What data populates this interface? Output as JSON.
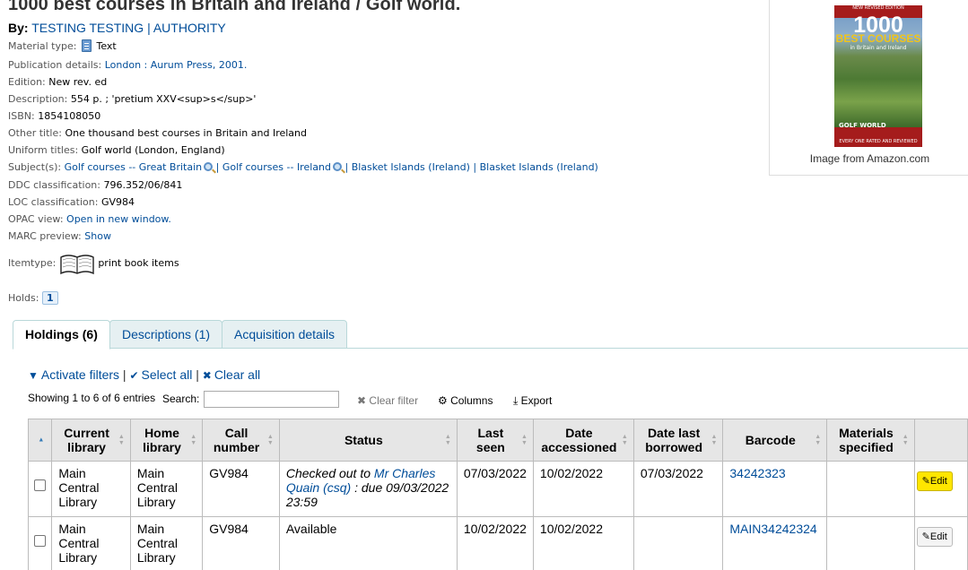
{
  "record": {
    "title": "1000 best courses in Britain and Ireland / Golf world.",
    "by_label": "By:",
    "authors": [
      "TESTING TESTING",
      "AUTHORITY"
    ],
    "author_sep": "|"
  },
  "fields": {
    "material_type": {
      "label": "Material type:",
      "value": "Text",
      "icon": "document-icon"
    },
    "publication": {
      "label": "Publication details:",
      "value": "London : Aurum Press, 2001."
    },
    "edition": {
      "label": "Edition:",
      "value": "New rev. ed"
    },
    "description": {
      "label": "Description:",
      "value": "554 p. ; 'pretium XXV<sup>s</sup>'"
    },
    "isbn": {
      "label": "ISBN:",
      "value": "1854108050"
    },
    "other_title": {
      "label": "Other title:",
      "value": "One thousand best courses in Britain and Ireland"
    },
    "uniform_titles": {
      "label": "Uniform titles:",
      "value": "Golf world (London, England)"
    },
    "subjects": {
      "label": "Subject(s):",
      "items": [
        "Golf courses -- Great Britain",
        "Golf courses -- Ireland",
        "Blasket Islands (Ireland)",
        "Blasket Islands (Ireland)"
      ],
      "sep": "|"
    },
    "ddc": {
      "label": "DDC classification:",
      "value": "796.352/06/841"
    },
    "loc": {
      "label": "LOC classification:",
      "value": "GV984"
    },
    "opac": {
      "label": "OPAC view:",
      "value": "Open in new window."
    },
    "marc": {
      "label": "MARC preview:",
      "value": "Show"
    },
    "itemtype": {
      "label": "Itemtype:",
      "value": "print book items",
      "icon": "open-book-icon"
    },
    "holds": {
      "label": "Holds:",
      "value": "1"
    }
  },
  "cover": {
    "caption": "Image from Amazon.com",
    "top_band": "NEW REVISED EDITION",
    "big": "1000",
    "sub": "BEST COURSES",
    "sub2": "in Britain and Ireland",
    "publisher_logo": "GOLF WORLD",
    "bottom_band": "EVERY ONE RATED AND REVIEWED"
  },
  "tabs": [
    {
      "label": "Holdings (6)",
      "active": true
    },
    {
      "label": "Descriptions (1)",
      "active": false
    },
    {
      "label": "Acquisition details",
      "active": false
    }
  ],
  "toolbar": {
    "activate_filters": "Activate filters",
    "select_all": "Select all",
    "clear_all": "Clear all",
    "showing": "Showing 1 to 6 of 6 entries",
    "search_label": "Search:",
    "clear_filter": "Clear filter",
    "columns": "Columns",
    "export": "Export",
    "pipe": "|"
  },
  "table": {
    "headers": [
      "Current library",
      "Home library",
      "Call number",
      "Status",
      "Last seen",
      "Date accessioned",
      "Date last borrowed",
      "Barcode",
      "Materials specified"
    ],
    "rows": [
      {
        "current_library": "Main Central Library",
        "home_library": "Main Central Library",
        "call_number": "GV984",
        "status_prefix": "Checked out to",
        "status_patron": "Mr Charles Quain (csq)",
        "status_suffix": ": due 09/03/2022 23:59",
        "last_seen": "07/03/2022",
        "date_accessioned": "10/02/2022",
        "date_last_borrowed": "07/03/2022",
        "barcode": "34242323",
        "materials": "",
        "edit": "Edit"
      },
      {
        "current_library": "Main Central Library",
        "home_library": "Main Central Library",
        "call_number": "GV984",
        "status": "Available",
        "last_seen": "10/02/2022",
        "date_accessioned": "10/02/2022",
        "date_last_borrowed": "",
        "barcode": "MAIN34242324",
        "materials": "",
        "edit": "Edit"
      }
    ]
  }
}
